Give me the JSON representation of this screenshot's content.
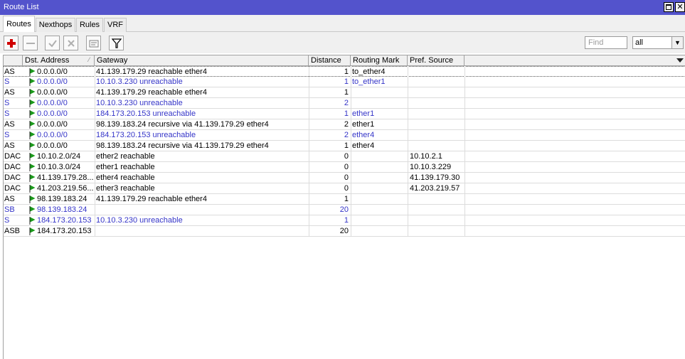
{
  "window": {
    "title": "Route List",
    "restore_icon": "restore-icon",
    "close_label": "✕"
  },
  "tabs": [
    {
      "label": "Routes",
      "active": true
    },
    {
      "label": "Nexthops",
      "active": false
    },
    {
      "label": "Rules",
      "active": false
    },
    {
      "label": "VRF",
      "active": false
    }
  ],
  "toolbar": {
    "buttons": [
      "add-icon",
      "remove-icon",
      "enable-icon",
      "disable-icon",
      "comment-icon",
      "filter-icon"
    ],
    "find_placeholder": "Find",
    "filter_value": "all"
  },
  "columns": [
    "",
    "Dst. Address",
    "Gateway",
    "Distance",
    "Routing Mark",
    "Pref. Source"
  ],
  "colors": {
    "active_text": "#000000",
    "inactive_text": "#3434c8",
    "flag": "#1a9a1a",
    "titlebar": "#5353cc"
  },
  "routes": [
    {
      "flags": "AS",
      "dst": "0.0.0.0/0",
      "gateway": "41.139.179.29 reachable ether4",
      "distance": "1",
      "mark": "to_ether4",
      "pref": "",
      "inactive": false,
      "selected": true
    },
    {
      "flags": "S",
      "dst": "0.0.0.0/0",
      "gateway": "10.10.3.230 unreachable",
      "distance": "1",
      "mark": "to_ether1",
      "pref": "",
      "inactive": true,
      "selected": false
    },
    {
      "flags": "AS",
      "dst": "0.0.0.0/0",
      "gateway": "41.139.179.29 reachable ether4",
      "distance": "1",
      "mark": "",
      "pref": "",
      "inactive": false,
      "selected": false
    },
    {
      "flags": "S",
      "dst": "0.0.0.0/0",
      "gateway": "10.10.3.230 unreachable",
      "distance": "2",
      "mark": "",
      "pref": "",
      "inactive": true,
      "selected": false
    },
    {
      "flags": "S",
      "dst": "0.0.0.0/0",
      "gateway": "184.173.20.153 unreachable",
      "distance": "1",
      "mark": "ether1",
      "pref": "",
      "inactive": true,
      "selected": false
    },
    {
      "flags": "AS",
      "dst": "0.0.0.0/0",
      "gateway": "98.139.183.24 recursive via 41.139.179.29 ether4",
      "distance": "2",
      "mark": "ether1",
      "pref": "",
      "inactive": false,
      "selected": false
    },
    {
      "flags": "S",
      "dst": "0.0.0.0/0",
      "gateway": "184.173.20.153 unreachable",
      "distance": "2",
      "mark": "ether4",
      "pref": "",
      "inactive": true,
      "selected": false
    },
    {
      "flags": "AS",
      "dst": "0.0.0.0/0",
      "gateway": "98.139.183.24 recursive via 41.139.179.29 ether4",
      "distance": "1",
      "mark": "ether4",
      "pref": "",
      "inactive": false,
      "selected": false
    },
    {
      "flags": "DAC",
      "dst": "10.10.2.0/24",
      "gateway": "ether2 reachable",
      "distance": "0",
      "mark": "",
      "pref": "10.10.2.1",
      "inactive": false,
      "selected": false
    },
    {
      "flags": "DAC",
      "dst": "10.10.3.0/24",
      "gateway": "ether1 reachable",
      "distance": "0",
      "mark": "",
      "pref": "10.10.3.229",
      "inactive": false,
      "selected": false
    },
    {
      "flags": "DAC",
      "dst": "41.139.179.28...",
      "gateway": "ether4 reachable",
      "distance": "0",
      "mark": "",
      "pref": "41.139.179.30",
      "inactive": false,
      "selected": false
    },
    {
      "flags": "DAC",
      "dst": "41.203.219.56...",
      "gateway": "ether3 reachable",
      "distance": "0",
      "mark": "",
      "pref": "41.203.219.57",
      "inactive": false,
      "selected": false
    },
    {
      "flags": "AS",
      "dst": "98.139.183.24",
      "gateway": "41.139.179.29 reachable ether4",
      "distance": "1",
      "mark": "",
      "pref": "",
      "inactive": false,
      "selected": false
    },
    {
      "flags": "SB",
      "dst": "98.139.183.24",
      "gateway": "",
      "distance": "20",
      "mark": "",
      "pref": "",
      "inactive": true,
      "selected": false
    },
    {
      "flags": "S",
      "dst": "184.173.20.153",
      "gateway": "10.10.3.230 unreachable",
      "distance": "1",
      "mark": "",
      "pref": "",
      "inactive": true,
      "selected": false
    },
    {
      "flags": "ASB",
      "dst": "184.173.20.153",
      "gateway": "",
      "distance": "20",
      "mark": "",
      "pref": "",
      "inactive": false,
      "selected": false
    }
  ]
}
